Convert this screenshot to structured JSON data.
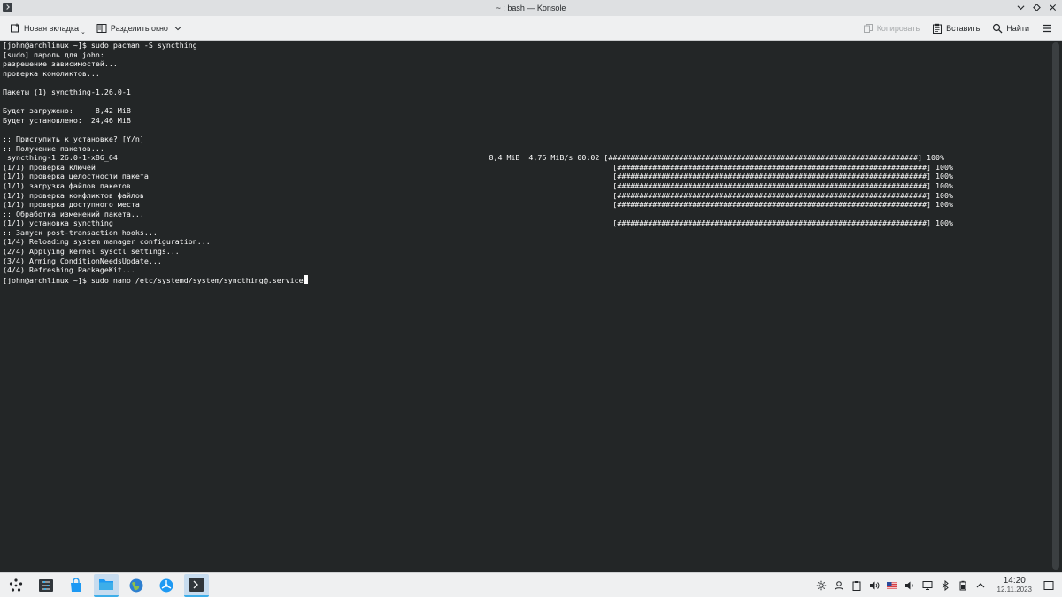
{
  "window": {
    "title": "~ : bash — Konsole"
  },
  "toolbar": {
    "new_tab": "Новая вкладка",
    "split_view": "Разделить окно",
    "copy": "Копировать",
    "paste": "Вставить",
    "find": "Найти"
  },
  "terminal": {
    "lines": [
      "[john@archlinux ~]$ sudo pacman -S syncthing",
      "[sudo] пароль для john:",
      "разрешение зависимостей...",
      "проверка конфликтов...",
      "",
      "Пакеты (1) syncthing-1.26.0-1",
      "",
      "Будет загружено:     8,42 MiB",
      "Будет установлено:  24,46 MiB",
      "",
      ":: Приступить к установке? [Y/n]",
      ":: Получение пакетов...",
      " syncthing-1.26.0-1-x86_64                                                                                    8,4 MiB  4,76 MiB/s 00:02 [######################################################################] 100%",
      "(1/1) проверка ключей                                                                                                                     [######################################################################] 100%",
      "(1/1) проверка целостности пакета                                                                                                         [######################################################################] 100%",
      "(1/1) загрузка файлов пакетов                                                                                                             [######################################################################] 100%",
      "(1/1) проверка конфликтов файлов                                                                                                          [######################################################################] 100%",
      "(1/1) проверка доступного места                                                                                                           [######################################################################] 100%",
      ":: Обработка изменений пакета...",
      "(1/1) установка syncthing                                                                                                                 [######################################################################] 100%",
      ":: Запуск post-transaction hooks...",
      "(1/4) Reloading system manager configuration...",
      "(2/4) Applying kernel sysctl settings...",
      "(3/4) Arming ConditionNeedsUpdate...",
      "(4/4) Refreshing PackageKit..."
    ],
    "prompt": "[john@archlinux ~]$ sudo nano /etc/systemd/system/syncthing@.service"
  },
  "taskbar": {
    "apps": [
      "app-launcher-icon",
      "system-settings-icon",
      "discover-icon",
      "dolphin-icon",
      "browser-icon",
      "network-app-icon",
      "konsole-icon"
    ],
    "keyboard_layout": "us",
    "time": "14:20",
    "date": "12.11.2023"
  },
  "colors": {
    "terminal_bg": "#232627",
    "terminal_fg": "#fcfcfc",
    "accent": "#3daee9"
  }
}
